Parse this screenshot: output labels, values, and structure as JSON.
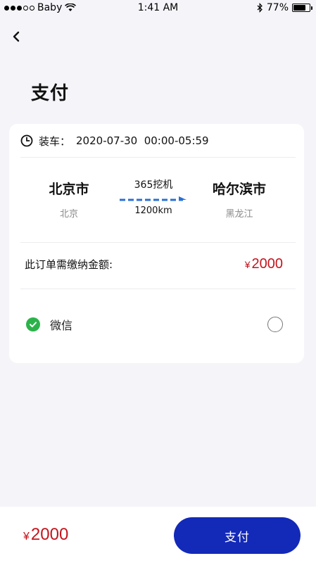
{
  "status_bar": {
    "carrier": "Baby",
    "time": "1:41 AM",
    "battery_percent": "77%",
    "battery_level": 0.77
  },
  "header": {
    "back_icon": "chevron-left-icon",
    "title": "支付"
  },
  "order": {
    "load_label": "装车：",
    "load_time": "2020-07-30  00:00-05:59",
    "from_city": "北京市",
    "from_province": "北京",
    "to_city": "哈尔滨市",
    "to_province": "黑龙江",
    "vehicle": "365挖机",
    "distance": "1200km",
    "amount_label": "此订单需缴纳金额:",
    "currency": "¥",
    "amount": "2000"
  },
  "payment_method": {
    "icon": "wechat-icon",
    "label": "微信",
    "selected": false
  },
  "footer": {
    "currency": "¥",
    "total": "2000",
    "pay_button_label": "支付"
  },
  "colors": {
    "accent": "#1329b8",
    "price": "#c6141c",
    "wechat": "#2bb34a",
    "route_arrow": "#2a6fd6"
  }
}
